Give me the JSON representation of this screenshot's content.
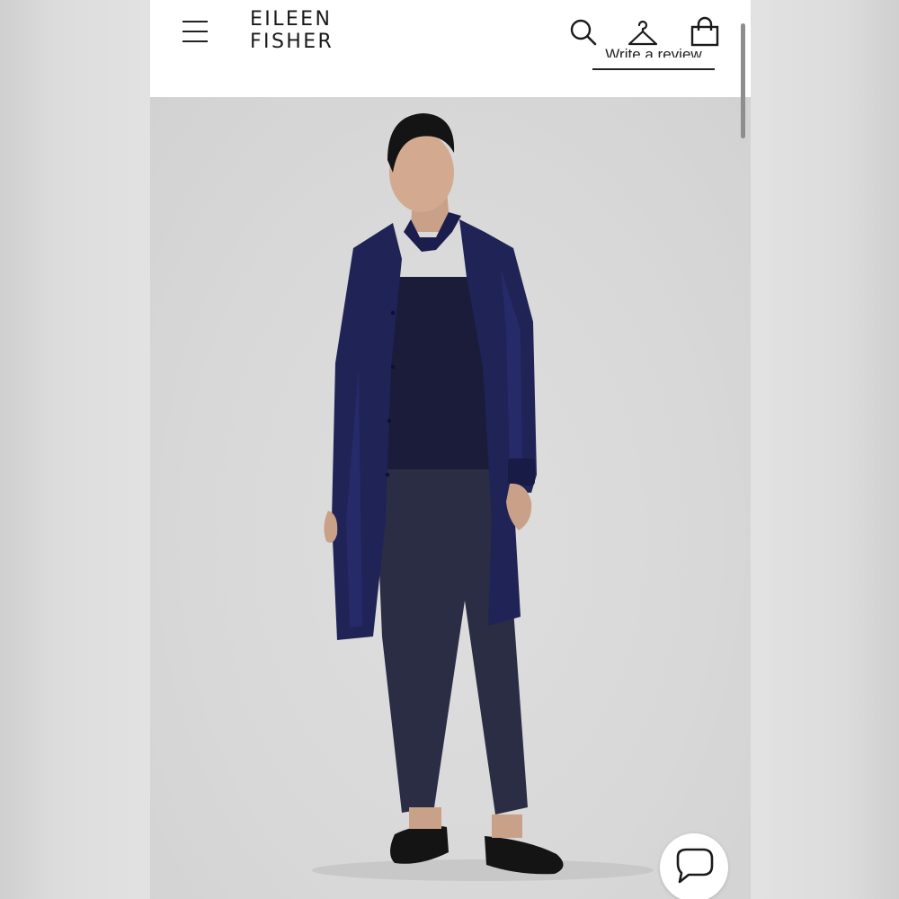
{
  "brand": {
    "line1": "EILEEN",
    "line2": "FISHER"
  },
  "header": {
    "menu_icon": "hamburger-menu-icon",
    "search_icon": "search-icon",
    "wishlist_icon": "hanger-icon",
    "cart_icon": "shopping-bag-icon",
    "review_link": "Write a review"
  },
  "product_image": {
    "alt": "Model wearing a long navy silk button-front shirt over a navy top and slim navy ankle pants with black flats"
  },
  "chat": {
    "icon": "chat-bubble-icon"
  },
  "colors": {
    "navy_garment": "#1e2152",
    "image_background": "#d9d9d9",
    "header_background": "#ffffff",
    "text": "#1a1a1a"
  }
}
